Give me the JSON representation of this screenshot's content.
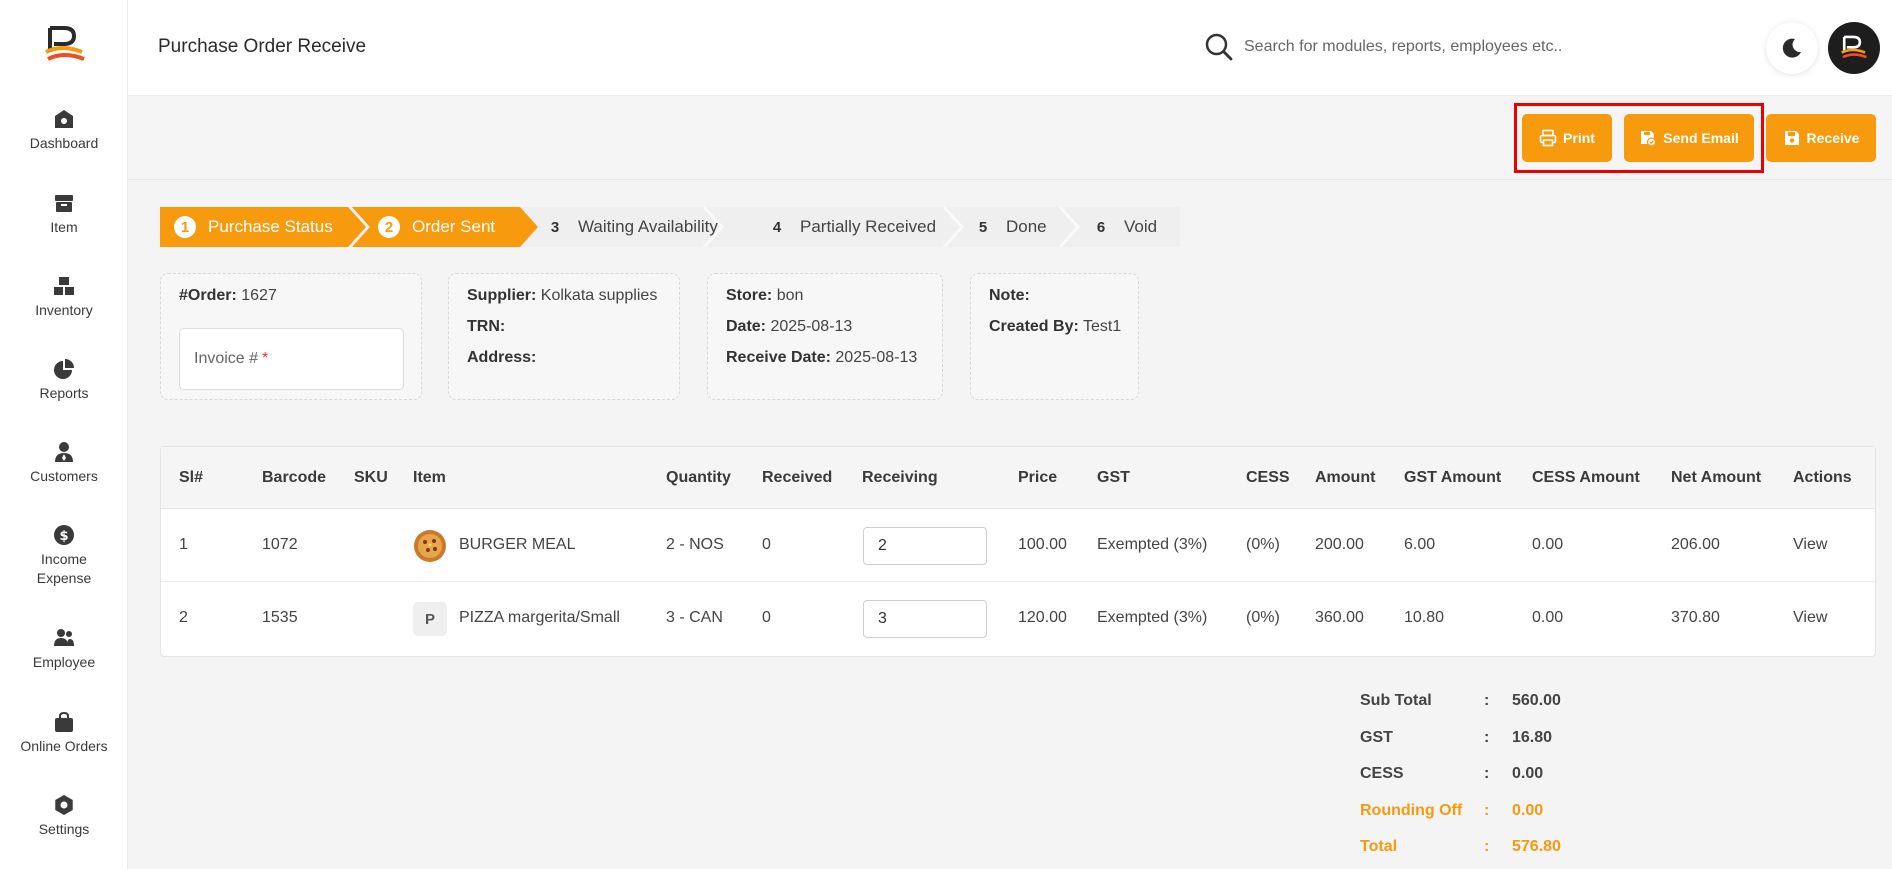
{
  "app": {
    "page_title": "Purchase Order Receive",
    "search": {
      "placeholder": "Search for modules, reports, employees etc.."
    }
  },
  "sidebar": {
    "items": [
      {
        "id": "dashboard",
        "label": "Dashboard",
        "icon": "home-icon"
      },
      {
        "id": "item",
        "label": "Item",
        "icon": "archive-icon"
      },
      {
        "id": "inventory",
        "label": "Inventory",
        "icon": "boxes-icon"
      },
      {
        "id": "reports",
        "label": "Reports",
        "icon": "pie-chart-icon"
      },
      {
        "id": "customers",
        "label": "Customers",
        "icon": "user-tie-icon"
      },
      {
        "id": "income-expense",
        "label_line1": "Income",
        "label_line2": "Expense",
        "icon": "dollar-icon"
      },
      {
        "id": "employee",
        "label": "Employee",
        "icon": "users-icon"
      },
      {
        "id": "online-orders",
        "label": "Online Orders",
        "icon": "shopping-bag-icon"
      },
      {
        "id": "settings",
        "label": "Settings",
        "icon": "gear-icon"
      }
    ]
  },
  "toolbar": {
    "print_label": "Print",
    "send_email_label": "Send Email",
    "receive_label": "Receive"
  },
  "steps": [
    {
      "num": "1",
      "label": "Purchase Status",
      "active": true
    },
    {
      "num": "2",
      "label": "Order Sent",
      "active": true
    },
    {
      "num": "3",
      "label": "Waiting Availability",
      "active": false
    },
    {
      "num": "4",
      "label": "Partially Received",
      "active": false
    },
    {
      "num": "5",
      "label": "Done",
      "active": false
    },
    {
      "num": "6",
      "label": "Void",
      "active": false
    }
  ],
  "order": {
    "order_label": "#Order:",
    "order_value": "1627",
    "invoice_placeholder": "Invoice #",
    "invoice_required": "*"
  },
  "supplier": {
    "supplier_label": "Supplier:",
    "supplier_value": "Kolkata supplies",
    "trn_label": "TRN:",
    "trn_value": "",
    "address_label": "Address:",
    "address_value": ""
  },
  "store": {
    "store_label": "Store:",
    "store_value": "bon",
    "date_label": "Date:",
    "date_value": "2025-08-13",
    "receive_date_label": "Receive Date:",
    "receive_date_value": "2025-08-13"
  },
  "note": {
    "note_label": "Note:",
    "note_value": "",
    "created_by_label": "Created By:",
    "created_by_value": "Test1"
  },
  "table": {
    "headers": {
      "sl": "Sl#",
      "barcode": "Barcode",
      "sku": "SKU",
      "item": "Item",
      "quantity": "Quantity",
      "received": "Received",
      "receiving": "Receiving",
      "price": "Price",
      "gst": "GST",
      "cess": "CESS",
      "amount": "Amount",
      "gst_amount": "GST Amount",
      "cess_amount": "CESS Amount",
      "net_amount": "Net Amount",
      "actions": "Actions"
    },
    "rows": [
      {
        "sl": "1",
        "barcode": "1072",
        "sku": "",
        "item": "BURGER MEAL",
        "thumb": "food-image",
        "quantity": "2 - NOS",
        "received": "0",
        "receiving": "2",
        "price": "100.00",
        "gst": "Exempted (3%)",
        "cess": "(0%)",
        "amount": "200.00",
        "gst_amount": "6.00",
        "cess_amount": "0.00",
        "net_amount": "206.00",
        "action": "View"
      },
      {
        "sl": "2",
        "barcode": "1535",
        "sku": "",
        "item": "PIZZA margerita/Small",
        "thumb_letter": "P",
        "quantity": "3 - CAN",
        "received": "0",
        "receiving": "3",
        "price": "120.00",
        "gst": "Exempted (3%)",
        "cess": "(0%)",
        "amount": "360.00",
        "gst_amount": "10.80",
        "cess_amount": "0.00",
        "net_amount": "370.80",
        "action": "View"
      }
    ]
  },
  "totals": {
    "separator": ":",
    "sub_total_label": "Sub Total",
    "sub_total_value": "560.00",
    "gst_label": "GST",
    "gst_value": "16.80",
    "cess_label": "CESS",
    "cess_value": "0.00",
    "rounding_label": "Rounding Off",
    "rounding_value": "0.00",
    "total_label": "Total",
    "total_value": "576.80"
  },
  "colors": {
    "accent": "#f79a0e",
    "highlight": "#ee0000"
  }
}
